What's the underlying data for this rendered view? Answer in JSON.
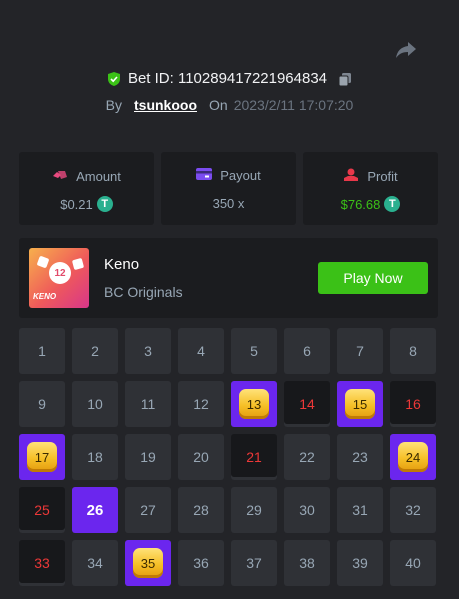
{
  "bet": {
    "id_label": "Bet ID: 110289417221964834",
    "by": "By",
    "user": "tsunkooo",
    "on": "On",
    "time": "2023/2/11 17:07:20"
  },
  "stats": {
    "amount": {
      "label": "Amount",
      "value": "$0.21"
    },
    "payout": {
      "label": "Payout",
      "value": "350 x"
    },
    "profit": {
      "label": "Profit",
      "value": "$76.68"
    }
  },
  "game": {
    "name": "Keno",
    "provider": "BC Originals",
    "play_label": "Play Now",
    "thumb_number": "12",
    "thumb_label": "KENO"
  },
  "colors": {
    "green": "#3bc117",
    "purple": "#6b26ee",
    "miss_red": "#ed3838",
    "gold": "#f6c027"
  },
  "board": {
    "cells": [
      {
        "n": "1",
        "state": "idle"
      },
      {
        "n": "2",
        "state": "idle"
      },
      {
        "n": "3",
        "state": "idle"
      },
      {
        "n": "4",
        "state": "idle"
      },
      {
        "n": "5",
        "state": "idle"
      },
      {
        "n": "6",
        "state": "idle"
      },
      {
        "n": "7",
        "state": "idle"
      },
      {
        "n": "8",
        "state": "idle"
      },
      {
        "n": "9",
        "state": "idle"
      },
      {
        "n": "10",
        "state": "idle"
      },
      {
        "n": "11",
        "state": "idle"
      },
      {
        "n": "12",
        "state": "idle"
      },
      {
        "n": "13",
        "state": "hit"
      },
      {
        "n": "14",
        "state": "miss"
      },
      {
        "n": "15",
        "state": "hit"
      },
      {
        "n": "16",
        "state": "miss"
      },
      {
        "n": "17",
        "state": "hit"
      },
      {
        "n": "18",
        "state": "idle"
      },
      {
        "n": "19",
        "state": "idle"
      },
      {
        "n": "20",
        "state": "idle"
      },
      {
        "n": "21",
        "state": "miss"
      },
      {
        "n": "22",
        "state": "idle"
      },
      {
        "n": "23",
        "state": "idle"
      },
      {
        "n": "24",
        "state": "hit"
      },
      {
        "n": "25",
        "state": "miss"
      },
      {
        "n": "26",
        "state": "picked"
      },
      {
        "n": "27",
        "state": "idle"
      },
      {
        "n": "28",
        "state": "idle"
      },
      {
        "n": "29",
        "state": "idle"
      },
      {
        "n": "30",
        "state": "idle"
      },
      {
        "n": "31",
        "state": "idle"
      },
      {
        "n": "32",
        "state": "idle"
      },
      {
        "n": "33",
        "state": "miss"
      },
      {
        "n": "34",
        "state": "idle"
      },
      {
        "n": "35",
        "state": "hit"
      },
      {
        "n": "36",
        "state": "idle"
      },
      {
        "n": "37",
        "state": "idle"
      },
      {
        "n": "38",
        "state": "idle"
      },
      {
        "n": "39",
        "state": "idle"
      },
      {
        "n": "40",
        "state": "idle"
      }
    ]
  }
}
